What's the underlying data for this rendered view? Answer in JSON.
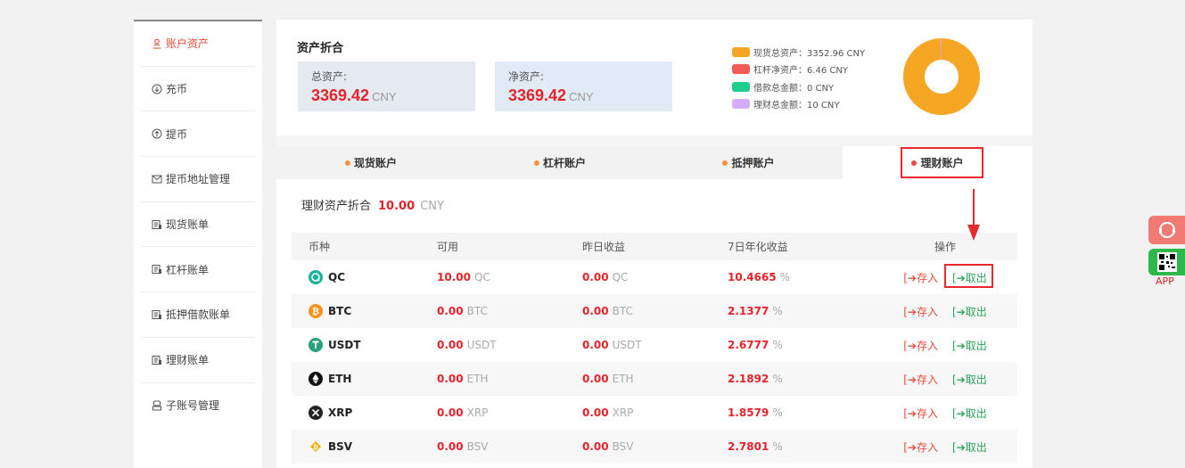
{
  "sidebar": {
    "items": [
      {
        "label": "账户资产",
        "icon": "account-icon",
        "active": true
      },
      {
        "label": "充币",
        "icon": "deposit-icon"
      },
      {
        "label": "提币",
        "icon": "withdraw-icon"
      },
      {
        "label": "提币地址管理",
        "icon": "address-book-icon"
      },
      {
        "label": "现货账单",
        "icon": "bill-icon"
      },
      {
        "label": "杠杆账单",
        "icon": "bill-icon"
      },
      {
        "label": "抵押借款账单",
        "icon": "bill-icon"
      },
      {
        "label": "理财账单",
        "icon": "bill-icon"
      },
      {
        "label": "子账号管理",
        "icon": "sub-account-icon"
      }
    ]
  },
  "summary": {
    "title": "资产折合",
    "total": {
      "label": "总资产:",
      "value": "3369.42",
      "unit": "CNY"
    },
    "net": {
      "label": "净资产:",
      "value": "3369.42",
      "unit": "CNY"
    },
    "legend": [
      {
        "label": "现货总资产：3352.96 CNY",
        "color": "#f5a623",
        "value": 3352.96
      },
      {
        "label": "杠杆净资产：6.46 CNY",
        "color": "#ef5c54",
        "value": 6.46
      },
      {
        "label": "借款总金额：0 CNY",
        "color": "#1ecf8b",
        "value": 0
      },
      {
        "label": "理财总金额：10 CNY",
        "color": "#d4aefc",
        "value": 10
      }
    ]
  },
  "tabs": [
    {
      "label": "现货账户",
      "active": false
    },
    {
      "label": "杠杆账户",
      "active": false
    },
    {
      "label": "抵押账户",
      "active": false
    },
    {
      "label": "理财账户",
      "active": true
    }
  ],
  "finance": {
    "label": "理财资产折合",
    "value": "10.00",
    "unit": "CNY"
  },
  "table": {
    "headers": [
      "币种",
      "可用",
      "昨日收益",
      "7日年化收益",
      "操作"
    ],
    "deposit_label": "[➔存入",
    "withdraw_label": "[➔取出",
    "rows": [
      {
        "coin": "QC",
        "icon": "qc-coin-icon",
        "color": "#1cb39a",
        "available": "10.00",
        "available_unit": "QC",
        "yesterday": "0.00",
        "yesterday_unit": "QC",
        "apy": "10.4665",
        "apy_unit": "%"
      },
      {
        "coin": "BTC",
        "icon": "btc-coin-icon",
        "color": "#f7931a",
        "available": "0.00",
        "available_unit": "BTC",
        "yesterday": "0.00",
        "yesterday_unit": "BTC",
        "apy": "2.1377",
        "apy_unit": "%"
      },
      {
        "coin": "USDT",
        "icon": "usdt-coin-icon",
        "color": "#26a17b",
        "available": "0.00",
        "available_unit": "USDT",
        "yesterday": "0.00",
        "yesterday_unit": "USDT",
        "apy": "2.6777",
        "apy_unit": "%"
      },
      {
        "coin": "ETH",
        "icon": "eth-coin-icon",
        "color": "#111111",
        "available": "0.00",
        "available_unit": "ETH",
        "yesterday": "0.00",
        "yesterday_unit": "ETH",
        "apy": "2.1892",
        "apy_unit": "%"
      },
      {
        "coin": "XRP",
        "icon": "xrp-coin-icon",
        "color": "#222222",
        "available": "0.00",
        "available_unit": "XRP",
        "yesterday": "0.00",
        "yesterday_unit": "XRP",
        "apy": "1.8579",
        "apy_unit": "%"
      },
      {
        "coin": "BSV",
        "icon": "bsv-coin-icon",
        "color": "#eab300",
        "available": "0.00",
        "available_unit": "BSV",
        "yesterday": "0.00",
        "yesterday_unit": "BSV",
        "apy": "2.7801",
        "apy_unit": "%"
      }
    ]
  },
  "floating": {
    "app_label": "APP"
  }
}
